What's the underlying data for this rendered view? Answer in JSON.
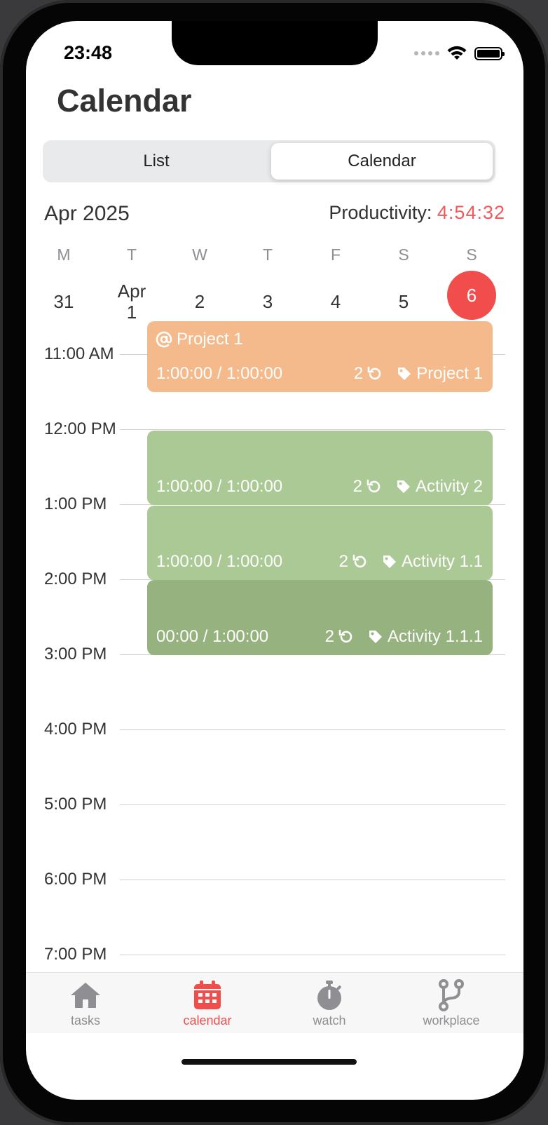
{
  "status": {
    "time": "23:48"
  },
  "header": {
    "title": "Calendar"
  },
  "segmented": {
    "list_label": "List",
    "calendar_label": "Calendar",
    "selected": "Calendar"
  },
  "summary": {
    "month": "Apr 2025",
    "productivity_label": "Productivity:",
    "productivity_value": "4:54:32"
  },
  "week": [
    {
      "letter": "M",
      "day": "31",
      "today": false
    },
    {
      "letter": "T",
      "day": "Apr\n1",
      "today": false
    },
    {
      "letter": "W",
      "day": "2",
      "today": false
    },
    {
      "letter": "T",
      "day": "3",
      "today": false
    },
    {
      "letter": "F",
      "day": "4",
      "today": false
    },
    {
      "letter": "S",
      "day": "5",
      "today": false
    },
    {
      "letter": "S",
      "day": "6",
      "today": true
    }
  ],
  "hours": [
    "11:00 AM",
    "12:00 PM",
    "1:00 PM",
    "2:00 PM",
    "3:00 PM",
    "4:00 PM",
    "5:00 PM",
    "6:00 PM",
    "7:00 PM"
  ],
  "events": [
    {
      "title": "Project 1",
      "progress": "1:00:00 / 1:00:00",
      "count": "2",
      "tag": "Project 1",
      "color": "#f5ba8b"
    },
    {
      "title": "",
      "progress": "1:00:00 / 1:00:00",
      "count": "2",
      "tag": "Activity 2",
      "color": "#abc994"
    },
    {
      "title": "",
      "progress": "1:00:00 / 1:00:00",
      "count": "2",
      "tag": "Activity 1.1",
      "color": "#abc994"
    },
    {
      "title": "",
      "progress": "00:00 / 1:00:00",
      "count": "2",
      "tag": "Activity 1.1.1",
      "color": "#96b27f"
    }
  ],
  "tabbar": {
    "tasks": "tasks",
    "calendar": "calendar",
    "watch": "watch",
    "workplace": "workplace",
    "active": "calendar",
    "active_color": "#f24d4d",
    "inactive_color": "#8e8e93"
  }
}
